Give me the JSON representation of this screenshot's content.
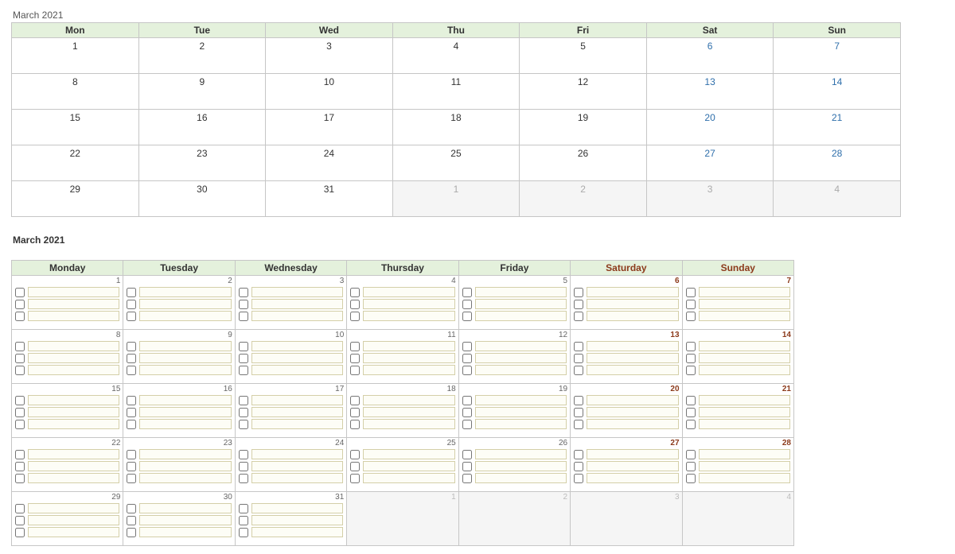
{
  "calendar1": {
    "title": "March 2021",
    "headers": [
      "Mon",
      "Tue",
      "Wed",
      "Thu",
      "Fri",
      "Sat",
      "Sun"
    ],
    "weeks": [
      [
        {
          "n": "1"
        },
        {
          "n": "2"
        },
        {
          "n": "3"
        },
        {
          "n": "4"
        },
        {
          "n": "5"
        },
        {
          "n": "6",
          "weekend": true
        },
        {
          "n": "7",
          "weekend": true
        }
      ],
      [
        {
          "n": "8"
        },
        {
          "n": "9"
        },
        {
          "n": "10"
        },
        {
          "n": "11"
        },
        {
          "n": "12"
        },
        {
          "n": "13",
          "weekend": true
        },
        {
          "n": "14",
          "weekend": true
        }
      ],
      [
        {
          "n": "15"
        },
        {
          "n": "16"
        },
        {
          "n": "17"
        },
        {
          "n": "18"
        },
        {
          "n": "19"
        },
        {
          "n": "20",
          "weekend": true
        },
        {
          "n": "21",
          "weekend": true
        }
      ],
      [
        {
          "n": "22"
        },
        {
          "n": "23"
        },
        {
          "n": "24"
        },
        {
          "n": "25"
        },
        {
          "n": "26"
        },
        {
          "n": "27",
          "weekend": true
        },
        {
          "n": "28",
          "weekend": true
        }
      ],
      [
        {
          "n": "29"
        },
        {
          "n": "30"
        },
        {
          "n": "31"
        },
        {
          "n": "1",
          "other": true
        },
        {
          "n": "2",
          "other": true
        },
        {
          "n": "3",
          "other": true,
          "weekend": true
        },
        {
          "n": "4",
          "other": true,
          "weekend": true
        }
      ]
    ]
  },
  "calendar2": {
    "title": "March 2021",
    "headers": [
      "Monday",
      "Tuesday",
      "Wednesday",
      "Thursday",
      "Friday",
      "Saturday",
      "Sunday"
    ],
    "weekend_cols": [
      5,
      6
    ],
    "tasks_per_day": 3,
    "weeks": [
      [
        {
          "n": "1"
        },
        {
          "n": "2"
        },
        {
          "n": "3"
        },
        {
          "n": "4"
        },
        {
          "n": "5"
        },
        {
          "n": "6",
          "weekend": true
        },
        {
          "n": "7",
          "weekend": true
        }
      ],
      [
        {
          "n": "8"
        },
        {
          "n": "9"
        },
        {
          "n": "10"
        },
        {
          "n": "11"
        },
        {
          "n": "12"
        },
        {
          "n": "13",
          "weekend": true
        },
        {
          "n": "14",
          "weekend": true
        }
      ],
      [
        {
          "n": "15"
        },
        {
          "n": "16"
        },
        {
          "n": "17"
        },
        {
          "n": "18"
        },
        {
          "n": "19"
        },
        {
          "n": "20",
          "weekend": true
        },
        {
          "n": "21",
          "weekend": true
        }
      ],
      [
        {
          "n": "22"
        },
        {
          "n": "23"
        },
        {
          "n": "24"
        },
        {
          "n": "25"
        },
        {
          "n": "26"
        },
        {
          "n": "27",
          "weekend": true
        },
        {
          "n": "28",
          "weekend": true
        }
      ],
      [
        {
          "n": "29"
        },
        {
          "n": "30"
        },
        {
          "n": "31"
        },
        {
          "n": "1",
          "other": true
        },
        {
          "n": "2",
          "other": true
        },
        {
          "n": "3",
          "other": true,
          "weekend": true
        },
        {
          "n": "4",
          "other": true,
          "weekend": true
        }
      ]
    ]
  }
}
